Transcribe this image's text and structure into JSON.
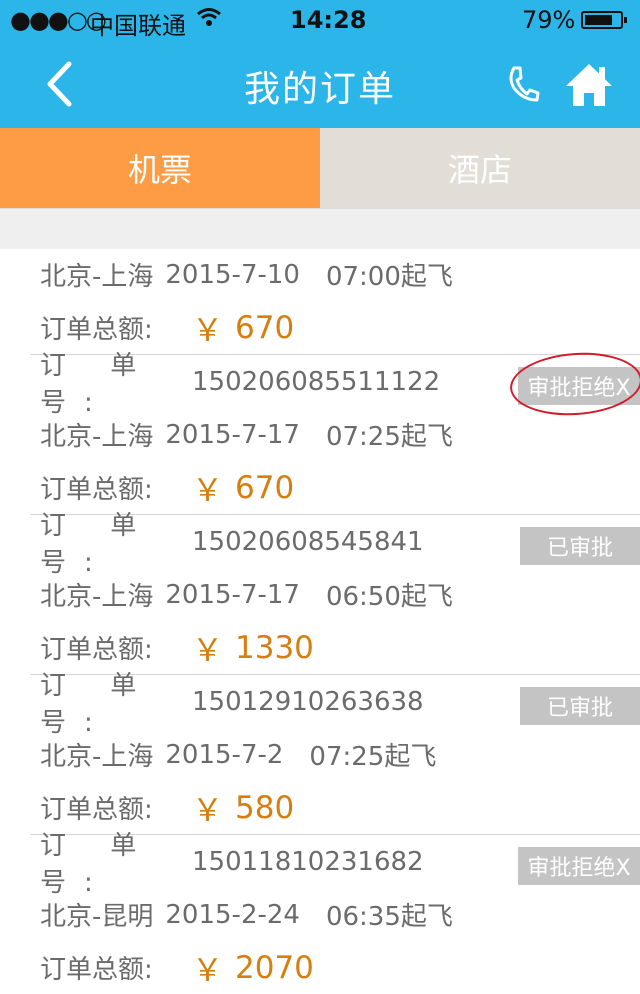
{
  "status_bar": {
    "signal": "●●●○○",
    "carrier": "中国联通",
    "time": "14:28",
    "battery_percent": "79%",
    "battery_level": 0.79
  },
  "nav": {
    "title": "我的订单",
    "back_icon": "chevron-left-icon",
    "phone_icon": "phone-icon",
    "home_icon": "home-icon"
  },
  "tabs": [
    {
      "label": "机票",
      "active": true
    },
    {
      "label": "酒店",
      "active": false
    }
  ],
  "labels": {
    "order_no": "订 单 号:",
    "total": "订单总额:",
    "currency": "￥"
  },
  "orders": [
    {
      "order_no": "",
      "route": "北京-上海",
      "date": "2015-7-10",
      "time": "07:00起飞",
      "amount": "670",
      "status": ""
    },
    {
      "order_no": "150206085511122",
      "route": "北京-上海",
      "date": "2015-7-17",
      "time": "07:25起飞",
      "amount": "670",
      "status": "审批拒绝X"
    },
    {
      "order_no": "15020608545841",
      "route": "北京-上海",
      "date": "2015-7-17",
      "time": "06:50起飞",
      "amount": "1330",
      "status": "已审批"
    },
    {
      "order_no": "15012910263638",
      "route": "北京-上海",
      "date": "2015-7-2",
      "time": "07:25起飞",
      "amount": "580",
      "status": "已审批"
    },
    {
      "order_no": "15011810231682",
      "route": "北京-昆明",
      "date": "2015-2-24",
      "time": "06:35起飞",
      "amount": "2070",
      "status": "审批拒绝X"
    }
  ],
  "colors": {
    "header": "#2bb5e8",
    "tab_active": "#fd9c45",
    "tab_inactive": "#e2ddd7",
    "amount": "#d67f10",
    "badge": "#c4c4c4",
    "annotation_circle": "#d21c2b"
  }
}
